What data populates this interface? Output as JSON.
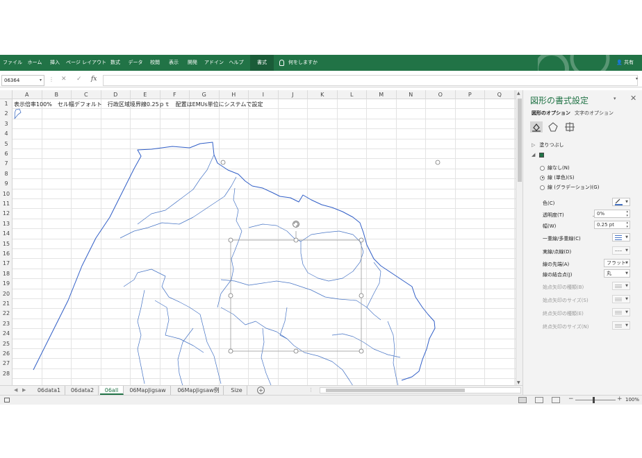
{
  "ribbon": {
    "tabs": [
      {
        "label": "ファイル"
      },
      {
        "label": "ホーム"
      },
      {
        "label": "挿入"
      },
      {
        "label": "ページ レイアウト"
      },
      {
        "label": "数式"
      },
      {
        "label": "データ"
      },
      {
        "label": "校閲"
      },
      {
        "label": "表示"
      },
      {
        "label": "開発"
      },
      {
        "label": "アドイン"
      },
      {
        "label": "ヘルプ"
      },
      {
        "label": "書式"
      }
    ],
    "active_tab": "書式",
    "tell_me": "何をしますか",
    "share": "共有",
    "colors": {
      "bg": "#217346",
      "active": "#1a5c38"
    }
  },
  "formula_bar": {
    "name_box": "06364",
    "cancel": "✕",
    "enter": "✓",
    "fx": "fx",
    "formula": ""
  },
  "columns": [
    "A",
    "B",
    "C",
    "D",
    "E",
    "F",
    "G",
    "H",
    "I",
    "J",
    "K",
    "L",
    "M",
    "N",
    "O",
    "P",
    "Q"
  ],
  "rows": [
    "1",
    "2",
    "3",
    "4",
    "5",
    "6",
    "7",
    "8",
    "9",
    "10",
    "11",
    "12",
    "13",
    "14",
    "15",
    "16",
    "17",
    "18",
    "19",
    "20",
    "21",
    "22",
    "23",
    "24",
    "25",
    "26",
    "27",
    "28"
  ],
  "cell_a1": "表示倍率100%　セル幅デフォルト　行政区域境界線0.25ｐｔ　配置はEMUs単位にシステムで設定",
  "sheet_tabs": [
    {
      "label": "06data1"
    },
    {
      "label": "06data2"
    },
    {
      "label": "06all"
    },
    {
      "label": "06MapJigsaw"
    },
    {
      "label": "06MapJigsaw例"
    },
    {
      "label": "Size"
    }
  ],
  "active_sheet": "06all",
  "status": {
    "zoom": "100%"
  },
  "format_pane": {
    "title": "図形の書式設定",
    "tab_shape_options": "図形のオプション",
    "tab_text_options": "文字のオプション",
    "icons": [
      "fill-line-icon",
      "effects-icon",
      "size-properties-icon"
    ],
    "section_fill": "塗りつぶし",
    "section_line": "線",
    "line_options": [
      {
        "label": "線なし(N)",
        "selected": false
      },
      {
        "label": "線 (単色)(S)",
        "selected": true
      },
      {
        "label": "線 (グラデーション)(G)",
        "selected": false
      }
    ],
    "properties": {
      "color_label": "色(C)",
      "transparency_label": "透明度(T)",
      "transparency_value": "0%",
      "width_label": "幅(W)",
      "width_value": "0.25 pt",
      "compound_label": "一重線/多重線(C)",
      "dash_label": "実線/点線(D)",
      "cap_label": "線の先端(A)",
      "cap_value": "フラット",
      "join_label": "線の結合点(J)",
      "join_value": "丸",
      "begin_arrow_type_label": "始点矢印の種類(B)",
      "begin_arrow_size_label": "始点矢印のサイズ(S)",
      "end_arrow_type_label": "終点矢印の種類(E)",
      "end_arrow_size_label": "終点矢印のサイズ(N)"
    },
    "colors": {
      "title": "#217346",
      "line_color": "#4472c4"
    }
  },
  "map": {
    "stroke_color": "#4472c4",
    "outer_stroke_color": "#2f5dc6"
  }
}
